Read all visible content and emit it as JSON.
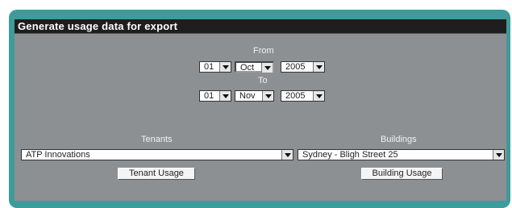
{
  "title": "Generate usage data for export",
  "from": {
    "label": "From",
    "day": "01",
    "month": "Oct",
    "year": "2005"
  },
  "to": {
    "label": "To",
    "day": "01",
    "month": "Nov",
    "year": "2005"
  },
  "tenants": {
    "label": "Tenants",
    "selected": "ATP Innovations",
    "button": "Tenant Usage"
  },
  "buildings": {
    "label": "Buildings",
    "selected": "Sydney - Bligh Street 25",
    "button": "Building Usage"
  },
  "colors": {
    "frame": "#3f9a9a",
    "panel": "#8c9092",
    "titlebar": "#1e1e1e"
  }
}
